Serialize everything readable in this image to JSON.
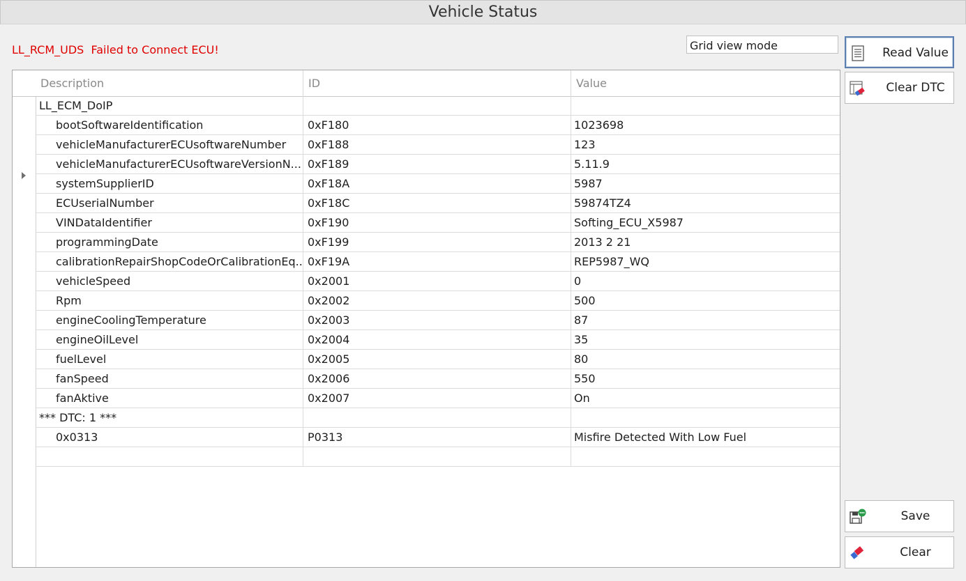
{
  "window": {
    "title": "Vehicle Status"
  },
  "status": {
    "error_message": "LL_RCM_UDS  Failed to Connect ECU!"
  },
  "view_mode": {
    "value": "Grid view mode"
  },
  "grid": {
    "columns": {
      "description": "Description",
      "id": "ID",
      "value": "Value"
    },
    "rows": [
      {
        "description": "LL_ECM_DoIP",
        "id": "",
        "value": ""
      },
      {
        "description": "bootSoftwareIdentification",
        "id": "0xF180",
        "value": "1023698"
      },
      {
        "description": "vehicleManufacturerECUsoftwareNumber",
        "id": "0xF188",
        "value": "123"
      },
      {
        "description": "vehicleManufacturerECUsoftwareVersionN...",
        "id": "0xF189",
        "value": "5.11.9"
      },
      {
        "description": "systemSupplierID",
        "id": "0xF18A",
        "value": "5987"
      },
      {
        "description": "ECUserialNumber",
        "id": "0xF18C",
        "value": "59874TZ4"
      },
      {
        "description": "VINDataIdentifier",
        "id": "0xF190",
        "value": "Softing_ECU_X5987"
      },
      {
        "description": "programmingDate",
        "id": "0xF199",
        "value": "2013 2 21"
      },
      {
        "description": "calibrationRepairShopCodeOrCalibrationEq...",
        "id": "0xF19A",
        "value": "REP5987_WQ"
      },
      {
        "description": "vehicleSpeed",
        "id": "0x2001",
        "value": "0"
      },
      {
        "description": "Rpm",
        "id": "0x2002",
        "value": "500"
      },
      {
        "description": "engineCoolingTemperature",
        "id": "0x2003",
        "value": "87"
      },
      {
        "description": "engineOilLevel",
        "id": "0x2004",
        "value": "35"
      },
      {
        "description": "fuelLevel",
        "id": "0x2005",
        "value": "80"
      },
      {
        "description": "fanSpeed",
        "id": "0x2006",
        "value": "550"
      },
      {
        "description": "fanAktive",
        "id": "0x2007",
        "value": "On"
      },
      {
        "description": "*** DTC: 1 ***",
        "id": "",
        "value": ""
      },
      {
        "description": "0x0313",
        "id": "P0313",
        "value": "Misfire Detected With Low Fuel"
      },
      {
        "description": "",
        "id": "",
        "value": ""
      }
    ]
  },
  "buttons": {
    "read_value": {
      "label": "Read Value",
      "icon": "document-lines-icon"
    },
    "clear_dtc": {
      "label": "Clear DTC",
      "icon": "eraser-table-icon"
    },
    "save": {
      "label": "Save",
      "icon": "save-disk-icon"
    },
    "clear": {
      "label": "Clear",
      "icon": "eraser-icon"
    }
  },
  "colors": {
    "error": "#e00000",
    "focus_border": "#5b7fb0"
  }
}
